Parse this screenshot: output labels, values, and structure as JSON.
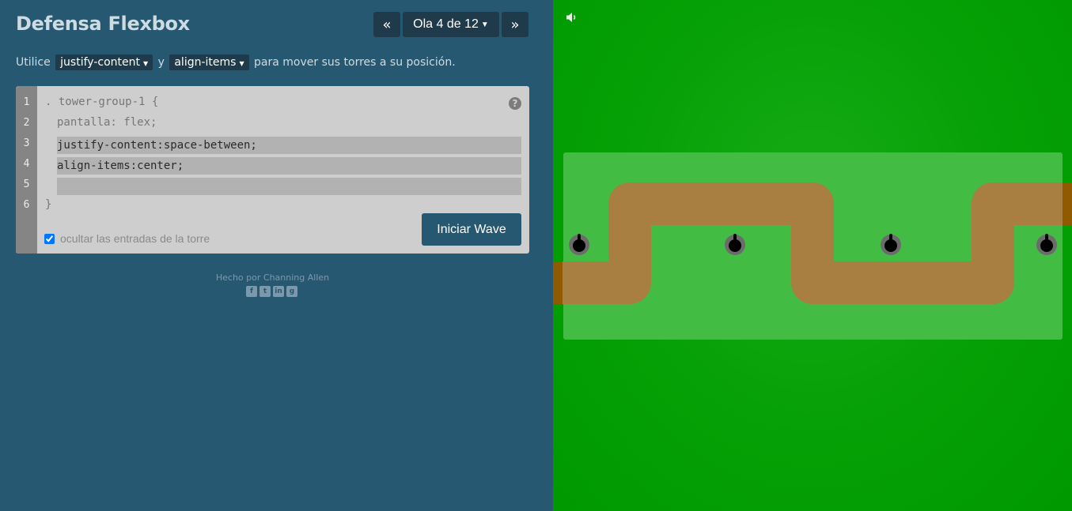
{
  "app": {
    "title": "Defensa Flexbox"
  },
  "nav": {
    "prev_icon": "«",
    "level_label": "Ola 4 de 12",
    "next_icon": "»"
  },
  "instructions": {
    "before": "Utilice",
    "prop1": "justify-content",
    "middle": "y",
    "prop2": "align-items",
    "after": "para mover sus torres a su posición."
  },
  "editor": {
    "line_numbers": [
      "1",
      "2",
      "3",
      "4",
      "5",
      "6"
    ],
    "line1": ". tower-group-1 {",
    "line2": "pantalla: flex;",
    "input1": "justify-content:space-between;",
    "input2": "align-items:center;",
    "input3": "",
    "line6": "}",
    "help_icon": "?",
    "checkbox_label": "ocultar las entradas de la torre",
    "checkbox_checked": true,
    "start_button": "Iniciar Wave"
  },
  "footer": {
    "credit": "Hecho por Channing Allen",
    "social_icons": [
      "facebook-icon",
      "twitter-icon",
      "linkedin-icon",
      "github-icon"
    ]
  },
  "game": {
    "colors": {
      "grass": "#05a005",
      "group_box": "#43bc43",
      "path": "#a87e41",
      "path_edge": "#8f5a00",
      "tower_ring": "#6b6b6b",
      "tower_core": "#000000"
    },
    "tower_count": 4
  }
}
